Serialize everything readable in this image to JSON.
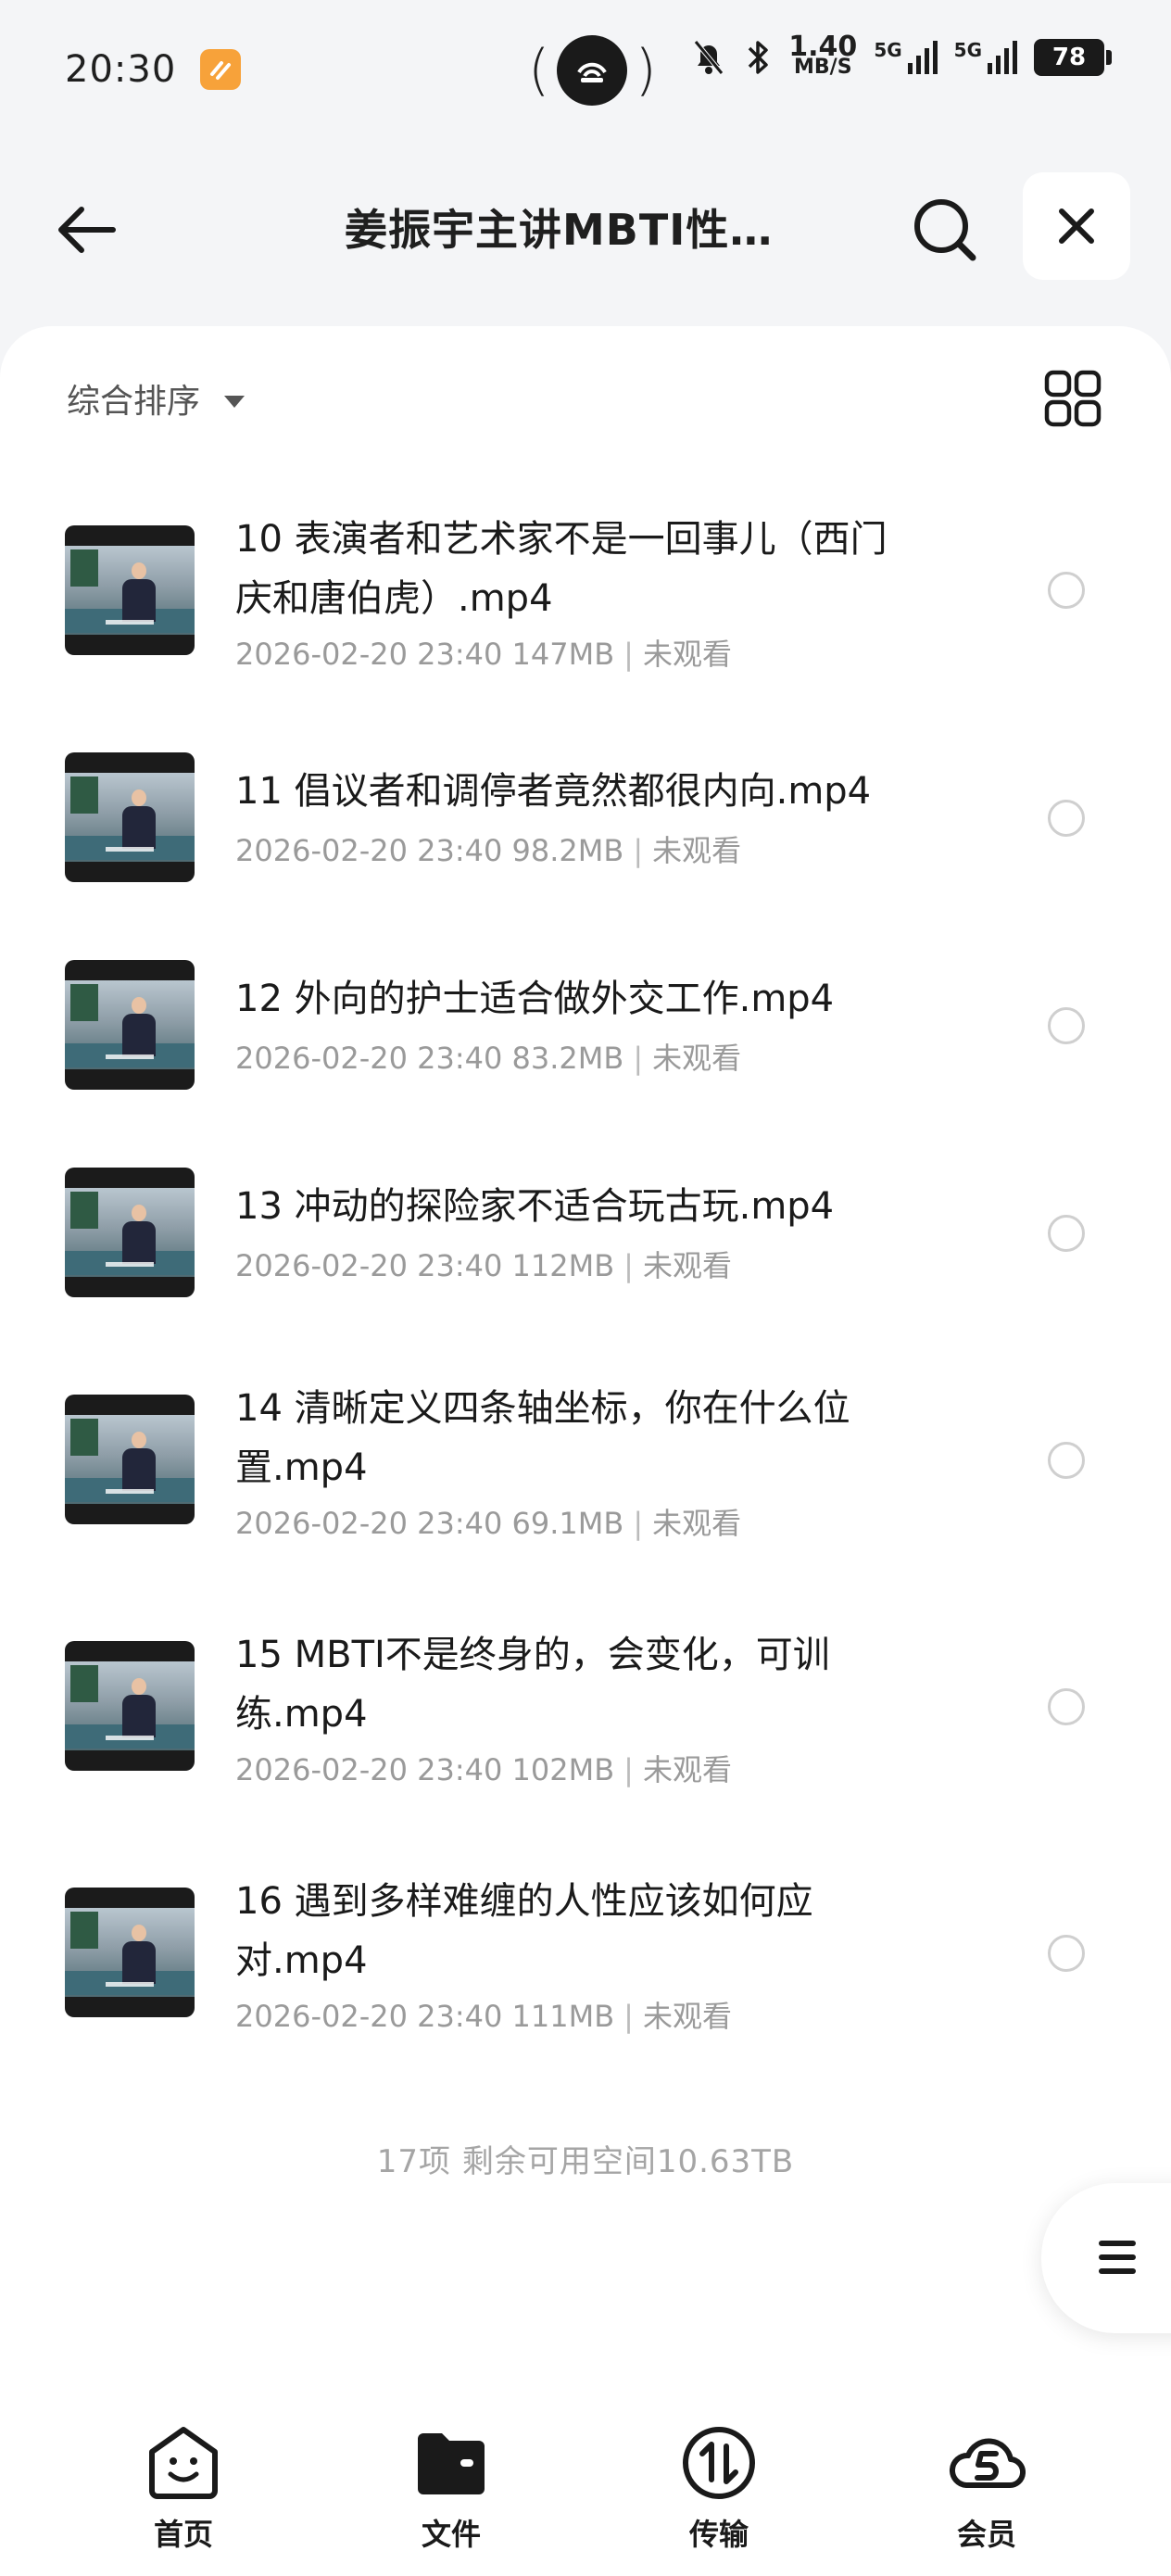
{
  "status_bar": {
    "time": "20:30",
    "net_speed_value": "1.40",
    "net_speed_unit": "MB/S",
    "signal1_label": "5G",
    "signal2_label": "5G",
    "battery": "78"
  },
  "header": {
    "title": "姜振宇主讲MBTI性…"
  },
  "toolbar": {
    "sort_label": "综合排序"
  },
  "files": [
    {
      "name": "10 表演者和艺术家不是一回事儿（西门庆和唐伯虎）.mp4",
      "date": "2026-02-20 23:40",
      "size": "147MB",
      "status": "未观看"
    },
    {
      "name": "11 倡议者和调停者竟然都很内向.mp4",
      "date": "2026-02-20 23:40",
      "size": "98.2MB",
      "status": "未观看"
    },
    {
      "name": "12 外向的护士适合做外交工作.mp4",
      "date": "2026-02-20 23:40",
      "size": "83.2MB",
      "status": "未观看"
    },
    {
      "name": "13 冲动的探险家不适合玩古玩.mp4",
      "date": "2026-02-20 23:40",
      "size": "112MB",
      "status": "未观看"
    },
    {
      "name": "14 清晰定义四条轴坐标，你在什么位置.mp4",
      "date": "2026-02-20 23:40",
      "size": "69.1MB",
      "status": "未观看"
    },
    {
      "name": "15 MBTI不是终身的，会变化，可训练.mp4",
      "date": "2026-02-20 23:40",
      "size": "102MB",
      "status": "未观看"
    },
    {
      "name": "16 遇到多样难缠的人性应该如何应对.mp4",
      "date": "2026-02-20 23:40",
      "size": "111MB",
      "status": "未观看"
    }
  ],
  "summary": "17项 剩余可用空间10.63TB",
  "tabbar": {
    "items": [
      {
        "label": "首页",
        "icon": "home-face-icon"
      },
      {
        "label": "文件",
        "icon": "folder-icon"
      },
      {
        "label": "传输",
        "icon": "transfer-icon"
      },
      {
        "label": "会员",
        "icon": "vip-cloud-icon"
      }
    ]
  }
}
